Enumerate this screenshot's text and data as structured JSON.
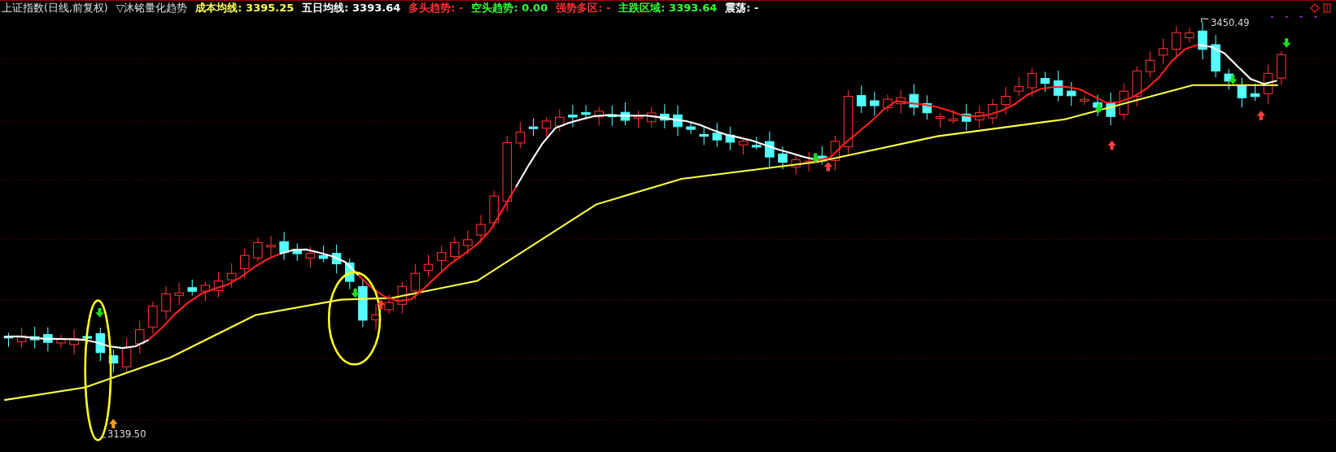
{
  "chart": {
    "title": "上证指数(日线,前复权)",
    "indicator": "▽沐铭量化趋势",
    "readings": [
      {
        "label": "成本均线:",
        "value": "3395.25",
        "color": "#ffff54"
      },
      {
        "label": "五日均线:",
        "value": "3393.64",
        "color": "#ffffff"
      },
      {
        "label": "多头趋势:",
        "value": "-",
        "color": "#ff3232"
      },
      {
        "label": "空头趋势:",
        "value": "0.00",
        "color": "#32ff32"
      },
      {
        "label": "强势多区:",
        "value": "-",
        "color": "#ff3232"
      },
      {
        "label": "主跌区域:",
        "value": "3393.64",
        "color": "#32ff32"
      },
      {
        "label": "震荡:",
        "value": "-",
        "color": "#ffffff"
      }
    ],
    "high_label": "3450.49",
    "low_label": "3139.50"
  }
}
